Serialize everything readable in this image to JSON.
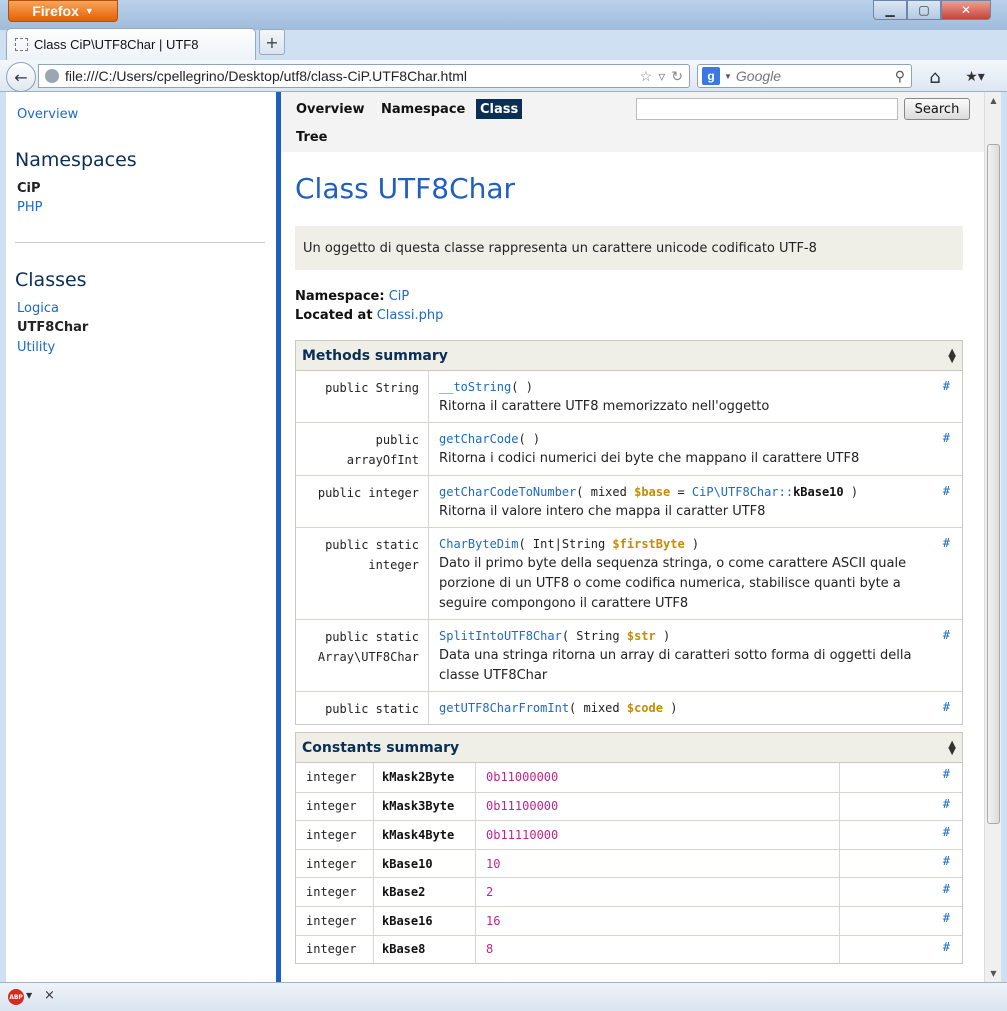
{
  "browser": {
    "menu_button": "Firefox",
    "tab_title": "Class CiP\\UTF8Char | UTF8",
    "new_tab": "+",
    "url": "file:///C:/Users/cpellegrino/Desktop/utf8/class-CiP.UTF8Char.html",
    "search_placeholder": "Google",
    "search_engine_letter": "g"
  },
  "sidebar": {
    "overview": "Overview",
    "namespaces_title": "Namespaces",
    "namespaces": [
      "CiP",
      "PHP"
    ],
    "classes_title": "Classes",
    "classes": [
      "Logica",
      "UTF8Char",
      "Utility"
    ]
  },
  "menu": {
    "overview": "Overview",
    "namespace": "Namespace",
    "class": "Class",
    "tree": "Tree",
    "search_button": "Search"
  },
  "page": {
    "title": "Class UTF8Char",
    "description": "Un oggetto di questa classe rappresenta un carattere unicode codificato UTF-8",
    "namespace_label": "Namespace:",
    "namespace_value": "CiP",
    "located_label": "Located at",
    "located_value": "Classi.php"
  },
  "methods": {
    "title": "Methods summary",
    "rows": [
      {
        "type1": "public String",
        "type2": "",
        "name": "__toString",
        "args_pre": "( )",
        "desc": "Ritorna il carattere UTF8 memorizzato nell'oggetto"
      },
      {
        "type1": "public",
        "type2": "arrayOfInt",
        "name": "getCharCode",
        "args_pre": "( )",
        "desc": "Ritorna i codici numerici dei byte che mappano il carattere UTF8"
      },
      {
        "type1": "public integer",
        "type2": "",
        "name": "getCharCodeToNumber",
        "args_pre": "( mixed",
        "var": "$base",
        "args_mid": " = ",
        "const_fn": "CiP\\UTF8Char::",
        "const": "kBase10",
        "args_post": " )",
        "desc": "Ritorna il valore intero che mappa il caratter UTF8"
      },
      {
        "type1": "public static",
        "type2": "integer",
        "name": "CharByteDim",
        "args_pre": "( Int|String",
        "var": "$firstByte",
        "args_post": " )",
        "desc": "Dato il primo byte della sequenza stringa, o come carattere ASCII quale porzione di un UTF8 o come codifica numerica, stabilisce quanti byte a seguire compongono il carattere UTF8"
      },
      {
        "type1": "public static",
        "type2": "Array\\UTF8Char",
        "name": "SplitIntoUTF8Char",
        "args_pre": "( String",
        "var": "$str",
        "args_post": " )",
        "desc": "Data una stringa ritorna un array di caratteri sotto forma di oggetti della classe UTF8Char"
      },
      {
        "type1": "public static",
        "type2": "",
        "name": "getUTF8CharFromInt",
        "args_pre": "( mixed",
        "var": "$code",
        "args_post": " )",
        "desc": ""
      }
    ]
  },
  "constants": {
    "title": "Constants summary",
    "rows": [
      {
        "type": "integer",
        "name": "kMask2Byte",
        "value": "0b11000000"
      },
      {
        "type": "integer",
        "name": "kMask3Byte",
        "value": "0b11100000"
      },
      {
        "type": "integer",
        "name": "kMask4Byte",
        "value": "0b11110000"
      },
      {
        "type": "integer",
        "name": "kBase10",
        "value": "10"
      },
      {
        "type": "integer",
        "name": "kBase2",
        "value": "2"
      },
      {
        "type": "integer",
        "name": "kBase16",
        "value": "16"
      },
      {
        "type": "integer",
        "name": "kBase8",
        "value": "8"
      }
    ]
  },
  "anchor": "#",
  "statusbar": {
    "abp": "ABP",
    "close": "×"
  }
}
